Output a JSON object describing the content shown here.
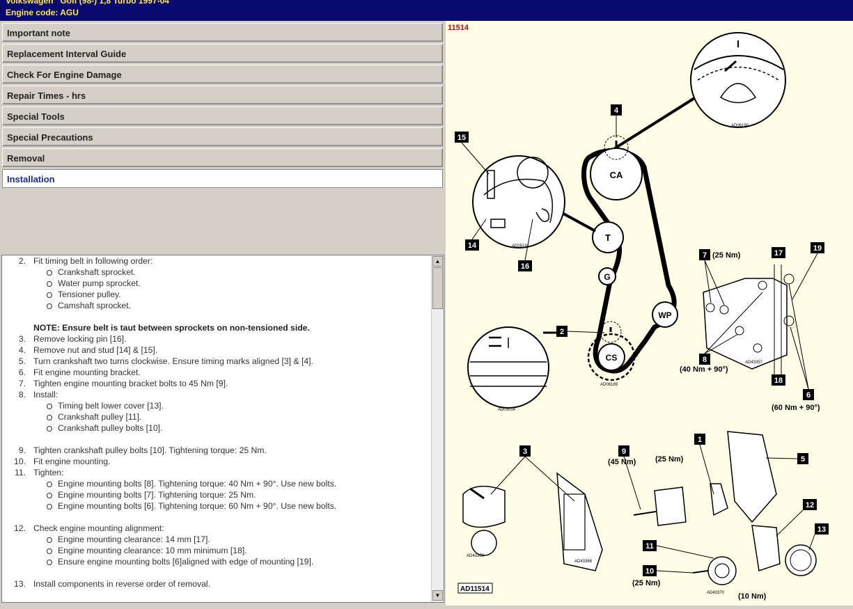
{
  "title": {
    "line1": "Volkswagen   Golf (98-) 1,8 Turbo 1997-04",
    "line2": "Engine code: AGU"
  },
  "nav": {
    "items": [
      {
        "label": "Important note"
      },
      {
        "label": "Replacement Interval Guide"
      },
      {
        "label": "Check For Engine Damage"
      },
      {
        "label": "Repair Times - hrs"
      },
      {
        "label": "Special Tools"
      },
      {
        "label": "Special Precautions"
      },
      {
        "label": "Removal"
      },
      {
        "label": "Installation"
      }
    ]
  },
  "instructions": {
    "step2": {
      "num": "2.",
      "text": "Fit timing belt in following order:",
      "sub": [
        "Crankshaft sprocket.",
        "Water pump sprocket.",
        "Tensioner pulley.",
        "Camshaft sprocket."
      ]
    },
    "note": "NOTE: Ensure belt is taut between sprockets on non-tensioned side.",
    "step3": {
      "num": "3.",
      "text": "Remove locking pin [16]."
    },
    "step4": {
      "num": "4.",
      "text": "Remove nut and stud [14] & [15]."
    },
    "step5": {
      "num": "5.",
      "text": "Turn crankshaft two turns clockwise. Ensure timing marks aligned [3] & [4]."
    },
    "step6": {
      "num": "6.",
      "text": "Fit engine mounting bracket."
    },
    "step7": {
      "num": "7.",
      "text": "Tighten engine mounting bracket bolts to 45 Nm [9]."
    },
    "step8": {
      "num": "8.",
      "text": "Install:",
      "sub": [
        "Timing belt lower cover [13].",
        "Crankshaft pulley [11].",
        "Crankshaft pulley bolts [10]."
      ]
    },
    "step9": {
      "num": "9.",
      "text": "Tighten crankshaft pulley bolts [10]. Tightening torque: 25 Nm."
    },
    "step10": {
      "num": "10.",
      "text": "Fit engine mounting."
    },
    "step11": {
      "num": "11.",
      "text": "Tighten:",
      "sub": [
        "Engine mounting bolts [8]. Tightening torque: 40 Nm + 90°. Use new bolts.",
        "Engine mounting bolts [7]. Tightening torque: 25 Nm.",
        "Engine mounting bolts [6]. Tightening torque: 60 Nm + 90°. Use new bolts."
      ]
    },
    "step12": {
      "num": "12.",
      "text": "Check engine mounting alignment:",
      "sub": [
        "Engine mounting clearance: 14 mm [17].",
        "Engine mounting clearance: 10 mm minimum [18].",
        "Ensure engine mounting bolts [6]aligned with edge of mounting [19]."
      ]
    },
    "step13": {
      "num": "13.",
      "text": "Install components in reverse order of removal."
    }
  },
  "diagram": {
    "id": "11514",
    "footer_code": "AD11514",
    "pulleys": {
      "ca": "CA",
      "t": "T",
      "g": "G",
      "wp": "WP",
      "cs": "CS"
    },
    "callouts": {
      "c1": "1",
      "c2": "2",
      "c3": "3",
      "c4": "4",
      "c5": "5",
      "c6": "6",
      "c7": "7",
      "c8": "8",
      "c9": "9",
      "c10": "10",
      "c11": "11",
      "c12": "12",
      "c13": "13",
      "c14": "14",
      "c15": "15",
      "c16": "16",
      "c17": "17",
      "c18": "18",
      "c19": "19"
    },
    "torques": {
      "t7": "(25 Nm)",
      "t8": "(40 Nm + 90°)",
      "t6": "(60 Nm + 90°)",
      "t9": "(45 Nm)",
      "t1": "(25 Nm)",
      "t10": "(25 Nm)",
      "t13": "(10 Nm)"
    },
    "refs": {
      "r1": "AD06190",
      "r2": "AD05191",
      "r3": "AD06189",
      "r4": "AD03014",
      "r5": "AD43357",
      "r6": "AD43369",
      "r7": "AD43366",
      "r8": "AD43370"
    }
  }
}
